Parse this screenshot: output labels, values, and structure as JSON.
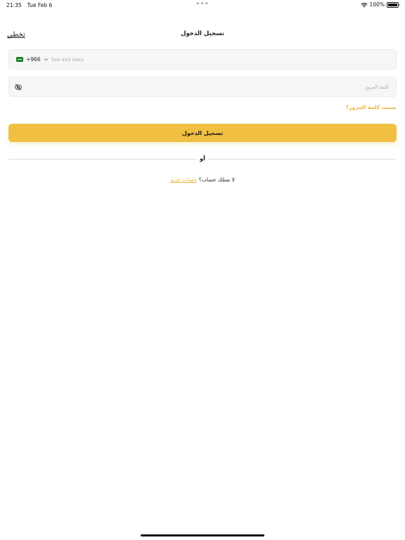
{
  "status_bar": {
    "time": "21:35",
    "date": "Tue Feb 6",
    "center_dots": "•••",
    "battery_text": "100%",
    "icons": [
      "wifi-icon",
      "battery-icon"
    ]
  },
  "header": {
    "title": "تسجيل الدخول",
    "skip_label": "تخطي"
  },
  "phone": {
    "country_flag": "saudi-flag-icon",
    "dial_code": "+966",
    "value": "",
    "placeholder": "5xx xxx xxxx"
  },
  "password": {
    "value": "",
    "placeholder": "كلمة المرور",
    "visibility_icon": "eye-slash-icon"
  },
  "forgot_password_label": "نسيت كلمة المرور؟",
  "login_button_label": "تسجيل الدخول",
  "divider_label": "أو",
  "signup": {
    "prompt": "لا تمتلك حساب؟",
    "link_label": "حساب جديد"
  },
  "colors": {
    "accent": "#f1c043",
    "link": "#e8b33a",
    "field_bg": "#f6f6f6"
  }
}
